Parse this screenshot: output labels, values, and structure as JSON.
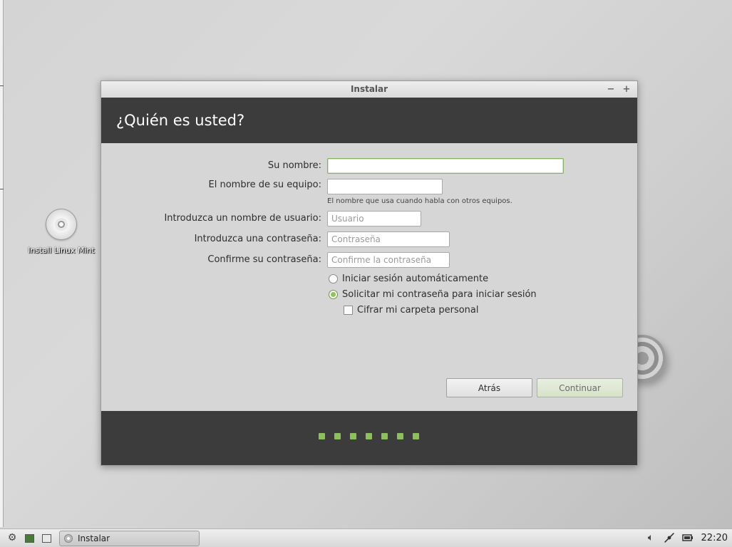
{
  "desktop": {
    "icon_label": "Install Linux Mint"
  },
  "window": {
    "title": "Instalar",
    "minimize_glyph": "−",
    "maximize_glyph": "+",
    "heading": "¿Quién es usted?"
  },
  "form": {
    "name_label": "Su nombre:",
    "name_value": "",
    "computer_label": "El nombre de su equipo:",
    "computer_value": "",
    "computer_hint": "El nombre que usa cuando habla con otros equipos.",
    "username_label": "Introduzca un nombre de usuario:",
    "username_placeholder": "Usuario",
    "password_label": "Introduzca una contraseña:",
    "password_placeholder": "Contraseña",
    "confirm_label": "Confirme su contraseña:",
    "confirm_placeholder": "Confirme la contraseña",
    "auto_login_label": "Iniciar sesión automáticamente",
    "auto_login_selected": false,
    "require_password_label": "Solicitar mi contraseña para iniciar sesión",
    "require_password_selected": true,
    "encrypt_home_label": "Cifrar mi carpeta personal",
    "encrypt_home_checked": false
  },
  "buttons": {
    "back": "Atrás",
    "continue": "Continuar"
  },
  "progress": {
    "steps": 7
  },
  "taskbar": {
    "task_label": "Instalar",
    "clock": "22:20"
  },
  "colors": {
    "accent_green": "#8cc05a",
    "banner_dark": "#3c3c3c",
    "window_bg": "#d6d6d6"
  },
  "icons": [
    "menu-gear-icon",
    "terminal-icon",
    "files-icon",
    "installer-disc-icon",
    "volume-icon",
    "network-icon",
    "battery-icon"
  ]
}
